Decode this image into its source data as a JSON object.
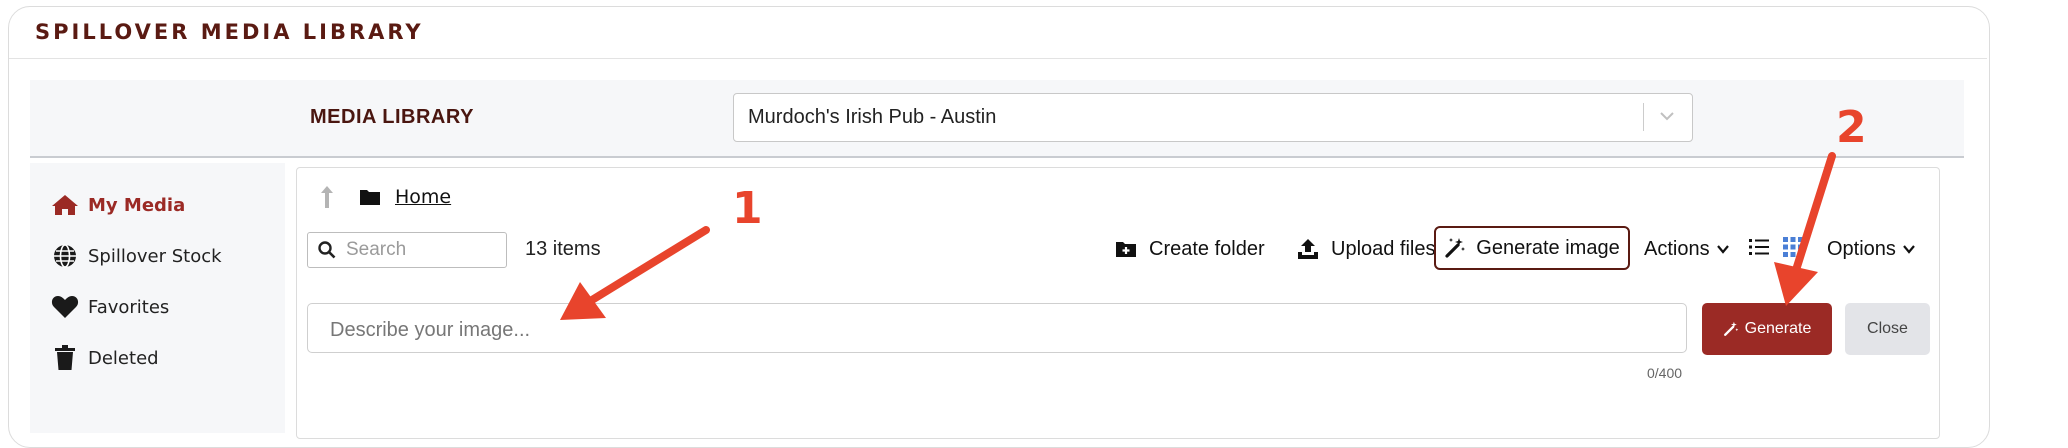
{
  "app": {
    "title": "SPILLOVER MEDIA LIBRARY"
  },
  "header": {
    "title": "MEDIA LIBRARY",
    "location_select": {
      "value": "Murdoch's Irish Pub - Austin"
    }
  },
  "sidebar": {
    "items": [
      {
        "label": "My Media",
        "icon": "home-icon",
        "active": true
      },
      {
        "label": "Spillover Stock",
        "icon": "globe-icon",
        "active": false
      },
      {
        "label": "Favorites",
        "icon": "heart-icon",
        "active": false
      },
      {
        "label": "Deleted",
        "icon": "trash-icon",
        "active": false
      }
    ]
  },
  "breadcrumb": {
    "home": "Home"
  },
  "toolbar": {
    "search_placeholder": "Search",
    "items_count": "13 items",
    "create_folder": "Create folder",
    "upload_files": "Upload files",
    "generate_image": "Generate image",
    "actions": "Actions",
    "options": "Options"
  },
  "generator": {
    "placeholder": "Describe your image...",
    "counter": "0/400",
    "generate_label": "Generate",
    "close_label": "Close"
  },
  "annotations": {
    "one": "1",
    "two": "2"
  },
  "colors": {
    "brand_dark": "#5a1a12",
    "accent": "#9b2a25",
    "annotation": "#e8442c",
    "view_icon_active": "#4a7fd6"
  }
}
